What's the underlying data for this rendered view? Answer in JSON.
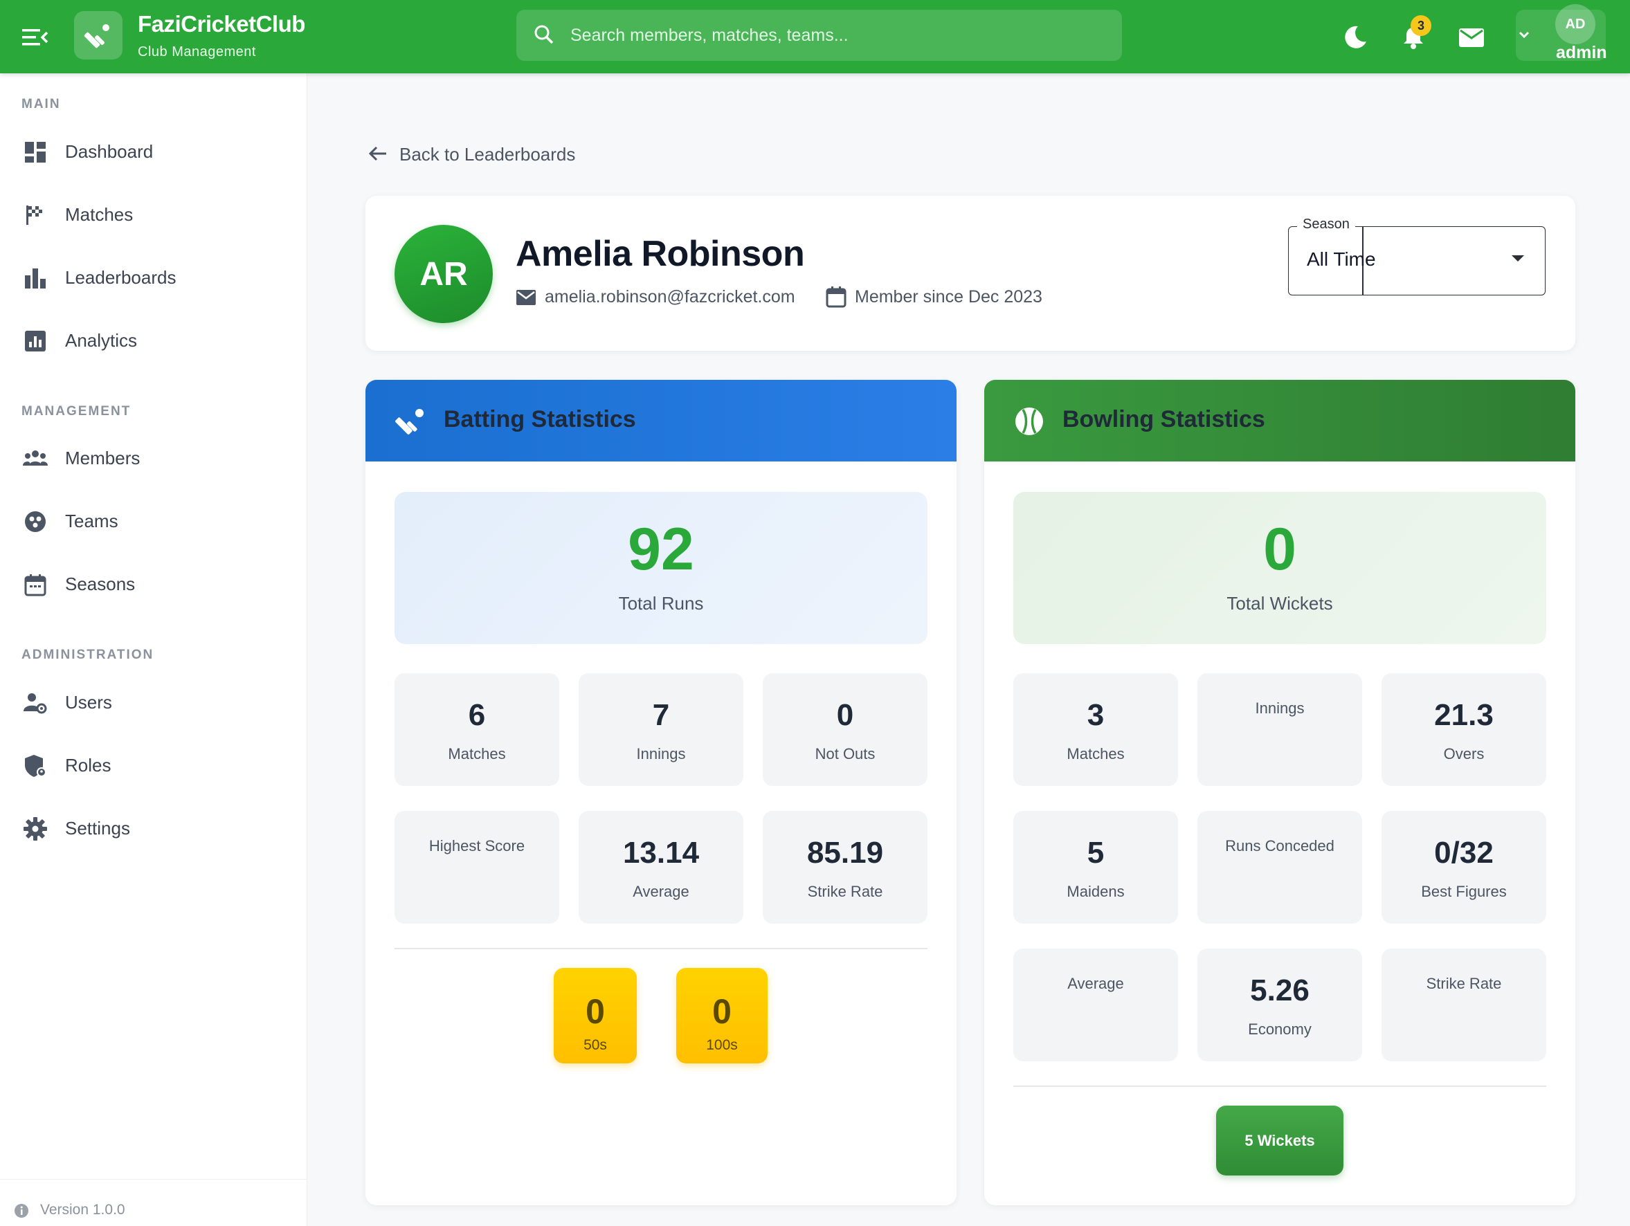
{
  "app": {
    "title": "FaziCricketClub",
    "subtitle": "Club Management"
  },
  "topbar": {
    "search_placeholder": "Search members, matches, teams...",
    "notification_count": "3",
    "user_initials": "AD",
    "user_name": "admin"
  },
  "sidebar": {
    "sections": [
      {
        "label": "MAIN",
        "items": [
          {
            "label": "Dashboard",
            "icon": "dashboard-icon"
          },
          {
            "label": "Matches",
            "icon": "flag-icon"
          },
          {
            "label": "Leaderboards",
            "icon": "bar-chart-icon"
          },
          {
            "label": "Analytics",
            "icon": "analytics-icon"
          }
        ]
      },
      {
        "label": "MANAGEMENT",
        "items": [
          {
            "label": "Members",
            "icon": "group-icon"
          },
          {
            "label": "Teams",
            "icon": "team-icon"
          },
          {
            "label": "Seasons",
            "icon": "calendar-icon"
          }
        ]
      },
      {
        "label": "ADMINISTRATION",
        "items": [
          {
            "label": "Users",
            "icon": "user-gear-icon"
          },
          {
            "label": "Roles",
            "icon": "shield-icon"
          },
          {
            "label": "Settings",
            "icon": "gear-icon"
          }
        ]
      }
    ],
    "version": "Version 1.0.0"
  },
  "main": {
    "back_label": "Back to Leaderboards",
    "profile": {
      "initials": "AR",
      "name": "Amelia Robinson",
      "email": "amelia.robinson@fazcricket.com",
      "member_since": "Member since Dec 2023"
    },
    "season": {
      "label": "Season",
      "value": "All Time"
    },
    "batting": {
      "title": "Batting Statistics",
      "total_runs": "92",
      "total_runs_label": "Total Runs",
      "tiles": [
        {
          "value": "6",
          "label": "Matches"
        },
        {
          "value": "7",
          "label": "Innings"
        },
        {
          "value": "0",
          "label": "Not Outs"
        },
        {
          "value": "",
          "label": "Highest Score"
        },
        {
          "value": "13.14",
          "label": "Average"
        },
        {
          "value": "85.19",
          "label": "Strike Rate"
        }
      ],
      "fifties": "0",
      "fifties_label": "50s",
      "hundreds": "0",
      "hundreds_label": "100s"
    },
    "bowling": {
      "title": "Bowling Statistics",
      "total_wickets": "0",
      "total_wickets_label": "Total Wickets",
      "tiles": [
        {
          "value": "3",
          "label": "Matches"
        },
        {
          "value": "",
          "label": "Innings"
        },
        {
          "value": "21.3",
          "label": "Overs"
        },
        {
          "value": "5",
          "label": "Maidens"
        },
        {
          "value": "",
          "label": "Runs Conceded"
        },
        {
          "value": "0/32",
          "label": "Best Figures"
        },
        {
          "value": "",
          "label": "Average"
        },
        {
          "value": "5.26",
          "label": "Economy"
        },
        {
          "value": "",
          "label": "Strike Rate"
        }
      ],
      "five_wickets_label": "5 Wickets"
    }
  },
  "colors": {
    "brand_green": "#2aa83a",
    "batting_blue": "#1a6fd0",
    "bowling_green": "#3a9a3f",
    "gold": "#ffc800"
  }
}
